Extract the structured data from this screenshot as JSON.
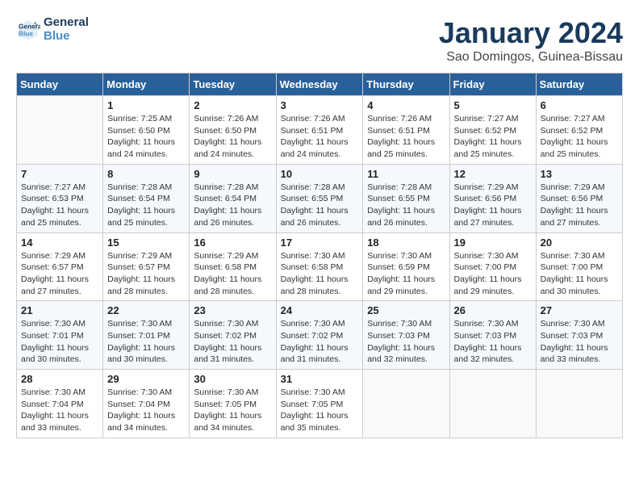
{
  "logo": {
    "text_general": "General",
    "text_blue": "Blue"
  },
  "title": "January 2024",
  "subtitle": "Sao Domingos, Guinea-Bissau",
  "days_of_week": [
    "Sunday",
    "Monday",
    "Tuesday",
    "Wednesday",
    "Thursday",
    "Friday",
    "Saturday"
  ],
  "weeks": [
    [
      {
        "day": "",
        "info": ""
      },
      {
        "day": "1",
        "info": "Sunrise: 7:25 AM\nSunset: 6:50 PM\nDaylight: 11 hours\nand 24 minutes."
      },
      {
        "day": "2",
        "info": "Sunrise: 7:26 AM\nSunset: 6:50 PM\nDaylight: 11 hours\nand 24 minutes."
      },
      {
        "day": "3",
        "info": "Sunrise: 7:26 AM\nSunset: 6:51 PM\nDaylight: 11 hours\nand 24 minutes."
      },
      {
        "day": "4",
        "info": "Sunrise: 7:26 AM\nSunset: 6:51 PM\nDaylight: 11 hours\nand 25 minutes."
      },
      {
        "day": "5",
        "info": "Sunrise: 7:27 AM\nSunset: 6:52 PM\nDaylight: 11 hours\nand 25 minutes."
      },
      {
        "day": "6",
        "info": "Sunrise: 7:27 AM\nSunset: 6:52 PM\nDaylight: 11 hours\nand 25 minutes."
      }
    ],
    [
      {
        "day": "7",
        "info": "Sunrise: 7:27 AM\nSunset: 6:53 PM\nDaylight: 11 hours\nand 25 minutes."
      },
      {
        "day": "8",
        "info": "Sunrise: 7:28 AM\nSunset: 6:54 PM\nDaylight: 11 hours\nand 25 minutes."
      },
      {
        "day": "9",
        "info": "Sunrise: 7:28 AM\nSunset: 6:54 PM\nDaylight: 11 hours\nand 26 minutes."
      },
      {
        "day": "10",
        "info": "Sunrise: 7:28 AM\nSunset: 6:55 PM\nDaylight: 11 hours\nand 26 minutes."
      },
      {
        "day": "11",
        "info": "Sunrise: 7:28 AM\nSunset: 6:55 PM\nDaylight: 11 hours\nand 26 minutes."
      },
      {
        "day": "12",
        "info": "Sunrise: 7:29 AM\nSunset: 6:56 PM\nDaylight: 11 hours\nand 27 minutes."
      },
      {
        "day": "13",
        "info": "Sunrise: 7:29 AM\nSunset: 6:56 PM\nDaylight: 11 hours\nand 27 minutes."
      }
    ],
    [
      {
        "day": "14",
        "info": "Sunrise: 7:29 AM\nSunset: 6:57 PM\nDaylight: 11 hours\nand 27 minutes."
      },
      {
        "day": "15",
        "info": "Sunrise: 7:29 AM\nSunset: 6:57 PM\nDaylight: 11 hours\nand 28 minutes."
      },
      {
        "day": "16",
        "info": "Sunrise: 7:29 AM\nSunset: 6:58 PM\nDaylight: 11 hours\nand 28 minutes."
      },
      {
        "day": "17",
        "info": "Sunrise: 7:30 AM\nSunset: 6:58 PM\nDaylight: 11 hours\nand 28 minutes."
      },
      {
        "day": "18",
        "info": "Sunrise: 7:30 AM\nSunset: 6:59 PM\nDaylight: 11 hours\nand 29 minutes."
      },
      {
        "day": "19",
        "info": "Sunrise: 7:30 AM\nSunset: 7:00 PM\nDaylight: 11 hours\nand 29 minutes."
      },
      {
        "day": "20",
        "info": "Sunrise: 7:30 AM\nSunset: 7:00 PM\nDaylight: 11 hours\nand 30 minutes."
      }
    ],
    [
      {
        "day": "21",
        "info": "Sunrise: 7:30 AM\nSunset: 7:01 PM\nDaylight: 11 hours\nand 30 minutes."
      },
      {
        "day": "22",
        "info": "Sunrise: 7:30 AM\nSunset: 7:01 PM\nDaylight: 11 hours\nand 30 minutes."
      },
      {
        "day": "23",
        "info": "Sunrise: 7:30 AM\nSunset: 7:02 PM\nDaylight: 11 hours\nand 31 minutes."
      },
      {
        "day": "24",
        "info": "Sunrise: 7:30 AM\nSunset: 7:02 PM\nDaylight: 11 hours\nand 31 minutes."
      },
      {
        "day": "25",
        "info": "Sunrise: 7:30 AM\nSunset: 7:03 PM\nDaylight: 11 hours\nand 32 minutes."
      },
      {
        "day": "26",
        "info": "Sunrise: 7:30 AM\nSunset: 7:03 PM\nDaylight: 11 hours\nand 32 minutes."
      },
      {
        "day": "27",
        "info": "Sunrise: 7:30 AM\nSunset: 7:03 PM\nDaylight: 11 hours\nand 33 minutes."
      }
    ],
    [
      {
        "day": "28",
        "info": "Sunrise: 7:30 AM\nSunset: 7:04 PM\nDaylight: 11 hours\nand 33 minutes."
      },
      {
        "day": "29",
        "info": "Sunrise: 7:30 AM\nSunset: 7:04 PM\nDaylight: 11 hours\nand 34 minutes."
      },
      {
        "day": "30",
        "info": "Sunrise: 7:30 AM\nSunset: 7:05 PM\nDaylight: 11 hours\nand 34 minutes."
      },
      {
        "day": "31",
        "info": "Sunrise: 7:30 AM\nSunset: 7:05 PM\nDaylight: 11 hours\nand 35 minutes."
      },
      {
        "day": "",
        "info": ""
      },
      {
        "day": "",
        "info": ""
      },
      {
        "day": "",
        "info": ""
      }
    ]
  ]
}
